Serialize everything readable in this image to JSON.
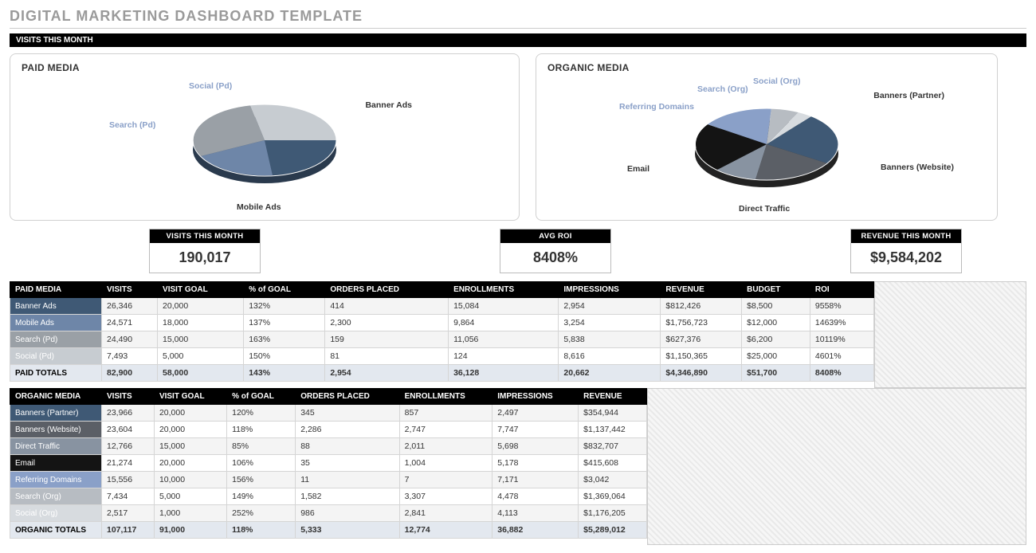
{
  "page_title": "DIGITAL MARKETING DASHBOARD TEMPLATE",
  "section_bar": "VISITS THIS MONTH",
  "charts": {
    "paid_title": "PAID MEDIA",
    "organic_title": "ORGANIC MEDIA",
    "paid_labels": {
      "banner": "Banner Ads",
      "mobile": "Mobile Ads",
      "search": "Search (Pd)",
      "social": "Social (Pd)"
    },
    "organic_labels": {
      "banners_partner": "Banners (Partner)",
      "banners_website": "Banners (Website)",
      "direct": "Direct Traffic",
      "email": "Email",
      "referring": "Referring Domains",
      "search": "Search (Org)",
      "social": "Social (Org)"
    }
  },
  "chart_data": [
    {
      "type": "pie",
      "title": "PAID MEDIA — Visits This Month",
      "series": [
        {
          "name": "Banner Ads",
          "value": 26346,
          "color": "#3f5975"
        },
        {
          "name": "Mobile Ads",
          "value": 24571,
          "color": "#6e86a8"
        },
        {
          "name": "Search (Pd)",
          "value": 24490,
          "color": "#9aa0a6"
        },
        {
          "name": "Social (Pd)",
          "value": 7493,
          "color": "#c7ccd1"
        }
      ]
    },
    {
      "type": "pie",
      "title": "ORGANIC MEDIA — Visits This Month",
      "series": [
        {
          "name": "Banners (Partner)",
          "value": 23966,
          "color": "#3f5975"
        },
        {
          "name": "Banners (Website)",
          "value": 23604,
          "color": "#5b5f66"
        },
        {
          "name": "Direct Traffic",
          "value": 12766,
          "color": "#8893a1"
        },
        {
          "name": "Email",
          "value": 21274,
          "color": "#141414"
        },
        {
          "name": "Referring Domains",
          "value": 15556,
          "color": "#8aa0c8"
        },
        {
          "name": "Search (Org)",
          "value": 7434,
          "color": "#b7bcc2"
        },
        {
          "name": "Social (Org)",
          "value": 2517,
          "color": "#d7dbdf"
        }
      ]
    }
  ],
  "kpis": [
    {
      "label": "VISITS THIS MONTH",
      "value": "190,017"
    },
    {
      "label": "AVG ROI",
      "value": "8408%"
    },
    {
      "label": "REVENUE THIS MONTH",
      "value": "$9,584,202"
    }
  ],
  "paid_table": {
    "headers": [
      "PAID MEDIA",
      "VISITS",
      "VISIT GOAL",
      "% of GOAL",
      "ORDERS PLACED",
      "ENROLLMENTS",
      "IMPRESSIONS",
      "REVENUE",
      "BUDGET",
      "ROI"
    ],
    "rows": [
      {
        "label": "Banner Ads",
        "color": "#3f5975",
        "cells": [
          "26,346",
          "20,000",
          "132%",
          "414",
          "15,084",
          "2,954",
          "$812,426",
          "$8,500",
          "9558%"
        ]
      },
      {
        "label": "Mobile Ads",
        "color": "#6e86a8",
        "cells": [
          "24,571",
          "18,000",
          "137%",
          "2,300",
          "9,864",
          "3,254",
          "$1,756,723",
          "$12,000",
          "14639%"
        ]
      },
      {
        "label": "Search (Pd)",
        "color": "#9aa0a6",
        "cells": [
          "24,490",
          "15,000",
          "163%",
          "159",
          "11,056",
          "5,838",
          "$627,376",
          "$6,200",
          "10119%"
        ]
      },
      {
        "label": "Social (Pd)",
        "color": "#c7ccd1",
        "cells": [
          "7,493",
          "5,000",
          "150%",
          "81",
          "124",
          "8,616",
          "$1,150,365",
          "$25,000",
          "4601%"
        ]
      }
    ],
    "totals": {
      "label": "PAID TOTALS",
      "cells": [
        "82,900",
        "58,000",
        "143%",
        "2,954",
        "36,128",
        "20,662",
        "$4,346,890",
        "$51,700",
        "8408%"
      ]
    }
  },
  "organic_table": {
    "headers": [
      "ORGANIC MEDIA",
      "VISITS",
      "VISIT GOAL",
      "% of GOAL",
      "ORDERS PLACED",
      "ENROLLMENTS",
      "IMPRESSIONS",
      "REVENUE"
    ],
    "rows": [
      {
        "label": "Banners (Partner)",
        "color": "#3f5975",
        "cells": [
          "23,966",
          "20,000",
          "120%",
          "345",
          "857",
          "2,497",
          "$354,944"
        ]
      },
      {
        "label": "Banners (Website)",
        "color": "#5b5f66",
        "cells": [
          "23,604",
          "20,000",
          "118%",
          "2,286",
          "2,747",
          "7,747",
          "$1,137,442"
        ]
      },
      {
        "label": "Direct Traffic",
        "color": "#8893a1",
        "cells": [
          "12,766",
          "15,000",
          "85%",
          "88",
          "2,011",
          "5,698",
          "$832,707"
        ]
      },
      {
        "label": "Email",
        "color": "#141414",
        "cells": [
          "21,274",
          "20,000",
          "106%",
          "35",
          "1,004",
          "5,178",
          "$415,608"
        ]
      },
      {
        "label": "Referring Domains",
        "color": "#8aa0c8",
        "cells": [
          "15,556",
          "10,000",
          "156%",
          "11",
          "7",
          "7,171",
          "$3,042"
        ]
      },
      {
        "label": "Search (Org)",
        "color": "#b7bcc2",
        "cells": [
          "7,434",
          "5,000",
          "149%",
          "1,582",
          "3,307",
          "4,478",
          "$1,369,064"
        ]
      },
      {
        "label": "Social (Org)",
        "color": "#d7dbdf",
        "cells": [
          "2,517",
          "1,000",
          "252%",
          "986",
          "2,841",
          "4,113",
          "$1,176,205"
        ]
      }
    ],
    "totals": {
      "label": "ORGANIC TOTALS",
      "cells": [
        "107,117",
        "91,000",
        "118%",
        "5,333",
        "12,774",
        "36,882",
        "$5,289,012"
      ]
    }
  }
}
